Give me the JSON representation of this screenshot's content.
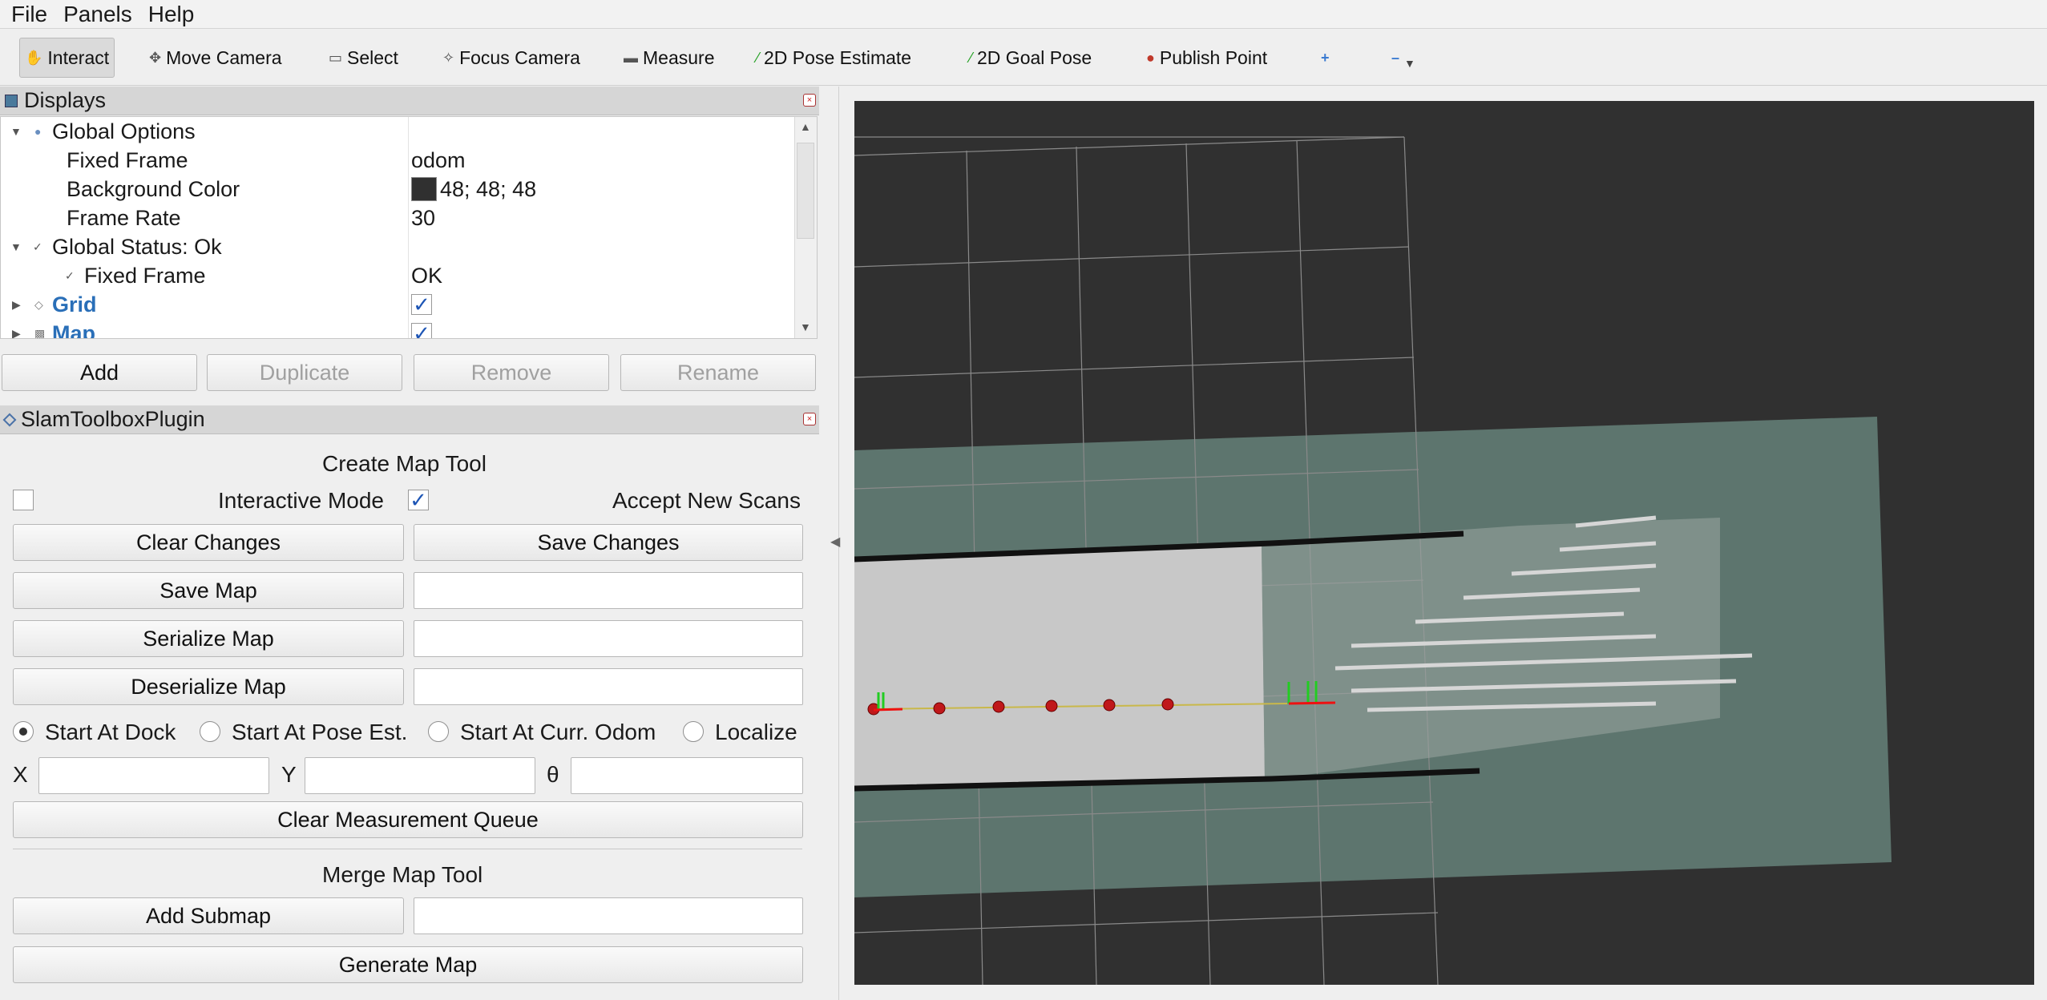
{
  "menu": {
    "file": "File",
    "panels": "Panels",
    "help": "Help"
  },
  "toolbar": {
    "interact": "Interact",
    "move_camera": "Move Camera",
    "select": "Select",
    "focus_camera": "Focus Camera",
    "measure": "Measure",
    "pose_estimate": "2D Pose Estimate",
    "goal_pose": "2D Goal Pose",
    "publish_point": "Publish Point"
  },
  "displays": {
    "title": "Displays",
    "rows": {
      "global_options": "Global Options",
      "fixed_frame_label": "Fixed Frame",
      "fixed_frame_value": "odom",
      "bg_color_label": "Background Color",
      "bg_color_value": "48; 48; 48",
      "frame_rate_label": "Frame Rate",
      "frame_rate_value": "30",
      "global_status": "Global Status: Ok",
      "status_fixed_frame_label": "Fixed Frame",
      "status_fixed_frame_value": "OK",
      "grid": "Grid",
      "map": "Map"
    },
    "buttons": {
      "add": "Add",
      "duplicate": "Duplicate",
      "remove": "Remove",
      "rename": "Rename"
    }
  },
  "slam": {
    "title": "SlamToolboxPlugin",
    "create_map_tool": "Create Map Tool",
    "interactive_mode": "Interactive Mode",
    "accept_new_scans": "Accept New Scans",
    "clear_changes": "Clear Changes",
    "save_changes": "Save Changes",
    "save_map": "Save Map",
    "serialize_map": "Serialize Map",
    "deserialize_map": "Deserialize Map",
    "start_at_dock": "Start At Dock",
    "start_at_pose_est": "Start At Pose Est.",
    "start_at_curr_odom": "Start At Curr. Odom",
    "localize": "Localize",
    "x_label": "X",
    "y_label": "Y",
    "theta_label": "θ",
    "clear_measurement_queue": "Clear Measurement Queue",
    "merge_map_tool": "Merge Map Tool",
    "add_submap": "Add Submap",
    "generate_map": "Generate Map"
  },
  "view": {
    "background_color": "#303030",
    "map_color": "#5d756e",
    "free_color": "#c8c8c8"
  }
}
